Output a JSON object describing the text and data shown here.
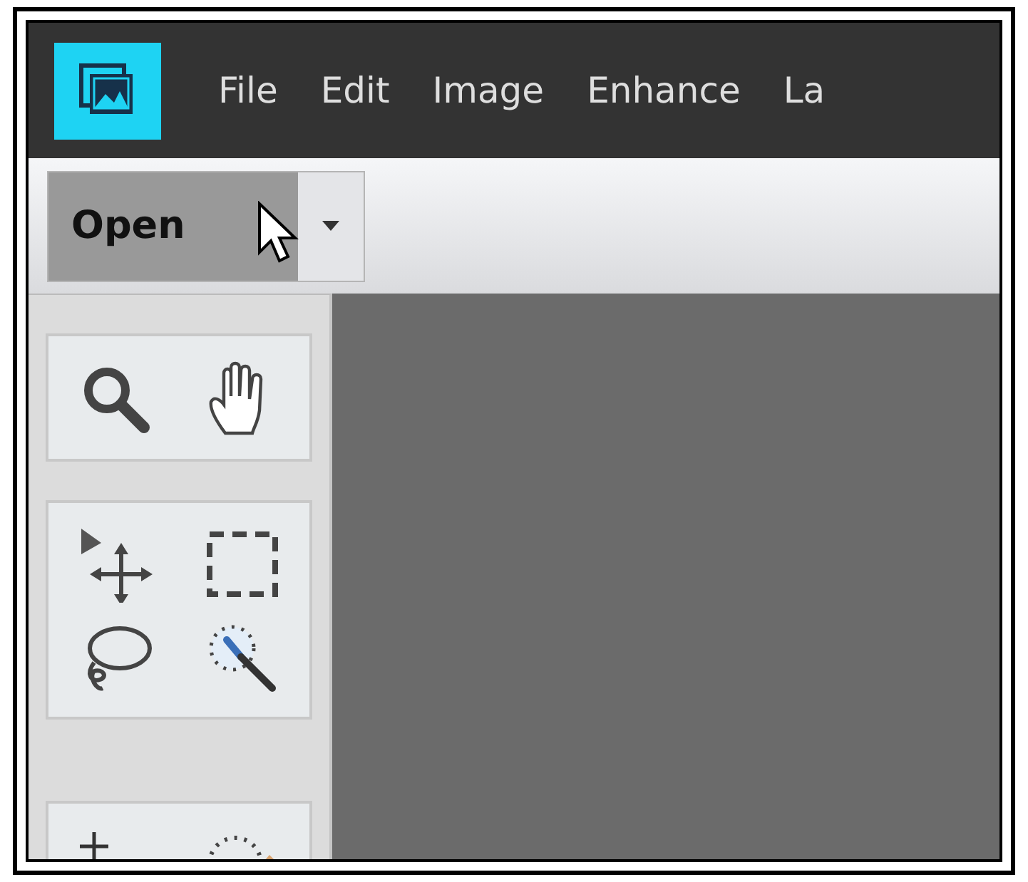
{
  "menu": {
    "items": [
      "File",
      "Edit",
      "Image",
      "Enhance",
      "La"
    ]
  },
  "toolbar": {
    "open_button": "Open"
  },
  "tool_groups": [
    {
      "tools": [
        {
          "kind": "zoom"
        },
        {
          "kind": "hand"
        }
      ]
    },
    {
      "tools": [
        {
          "kind": "move"
        },
        {
          "kind": "marquee"
        },
        {
          "kind": "lasso"
        },
        {
          "kind": "quick-selection"
        }
      ]
    },
    {
      "tools": [
        {
          "kind": "red-eye"
        },
        {
          "kind": "healing"
        }
      ]
    }
  ]
}
